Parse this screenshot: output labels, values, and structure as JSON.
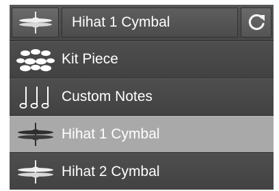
{
  "header": {
    "icon": "hihat-cymbal-icon",
    "title": "Hihat 1 Cymbal",
    "refresh_icon": "refresh-icon"
  },
  "menu": {
    "items": [
      {
        "label": "Kit Piece",
        "icon": "drum-kit-icon",
        "selected": false
      },
      {
        "label": "Custom Notes",
        "icon": "music-notes-icon",
        "selected": false
      },
      {
        "label": "Hihat 1 Cymbal",
        "icon": "hihat-cymbal-icon",
        "selected": true
      },
      {
        "label": "Hihat 2 Cymbal",
        "icon": "hihat-cymbal-icon",
        "selected": false
      }
    ]
  },
  "colors": {
    "panel": "#3c3c3c",
    "header": "#4c4c4c",
    "selected_row": "#a9a9a9",
    "text": "#ffffff"
  }
}
